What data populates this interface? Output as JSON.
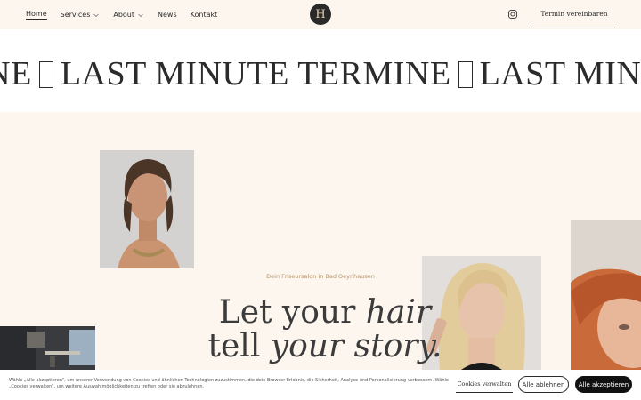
{
  "header": {
    "nav": [
      {
        "label": "Home"
      },
      {
        "label": "Services"
      },
      {
        "label": "About"
      },
      {
        "label": "News"
      },
      {
        "label": "Kontakt"
      }
    ],
    "cta_label": "Termin vereinbaren",
    "logo_monogram": "H"
  },
  "marquee": {
    "text1": "INE",
    "text2": "LAST MINUTE TERMINE",
    "text3": "LAST MINUT"
  },
  "hero": {
    "subtitle": "Dein Friseursalon in Bad Oeynhausen",
    "line1_a": "Let your ",
    "line1_b": "hair",
    "line2_a": "tell ",
    "line2_b": "your story."
  },
  "cookie": {
    "text": "Wähle „Alle akzeptieren“, um unserer Verwendung von Cookies und ähnlichen Technologien zuzustimmen, die dein Browser-Erlebnis, die Sicherheit, Analyse und Personalisierung verbessern. Wähle „Cookies verwalten“, um weitere Auswahlmöglichkeiten zu treffen oder sie abzulehnen.",
    "manage_label": "Cookies verwalten",
    "decline_label": "Alle ablehnen",
    "accept_label": "Alle akzeptieren"
  }
}
